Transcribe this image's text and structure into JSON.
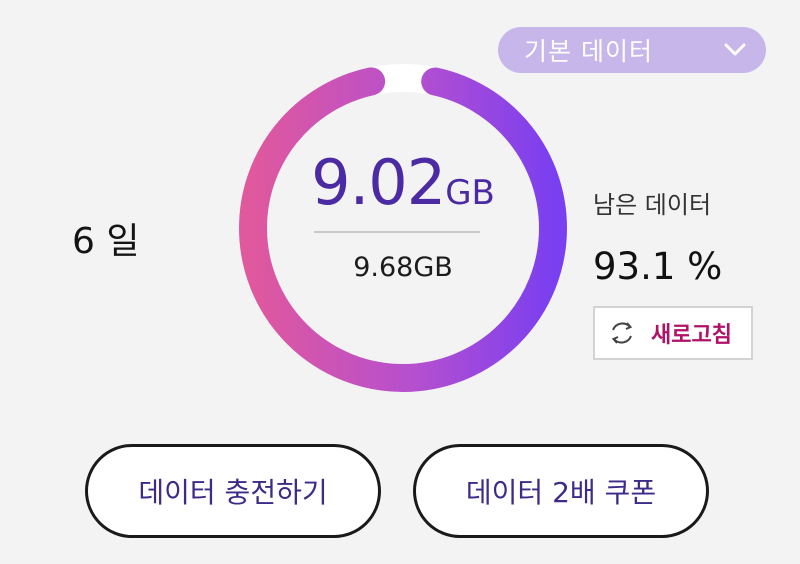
{
  "plan_select": {
    "selected": "기본 데이터",
    "icon": "chevron-down-icon"
  },
  "usage": {
    "days_left": "6 일",
    "remaining_value": "9.02",
    "remaining_unit": "GB",
    "total": "9.68GB",
    "remaining_label": "남은 데이터",
    "remaining_percent": "93.1 %",
    "ring_fill_fraction": 0.931
  },
  "refresh": {
    "label": "새로고침",
    "icon": "refresh-icon"
  },
  "actions": {
    "charge_label": "데이터 충전하기",
    "coupon_label": "데이터 2배 쿠폰"
  },
  "colors": {
    "ring_top": "#e0589e",
    "ring_bottom": "#7a3ff0",
    "accent_purple": "#4b2aa4",
    "dropdown_bg": "#c6b6ea",
    "refresh_text": "#b0126a"
  }
}
